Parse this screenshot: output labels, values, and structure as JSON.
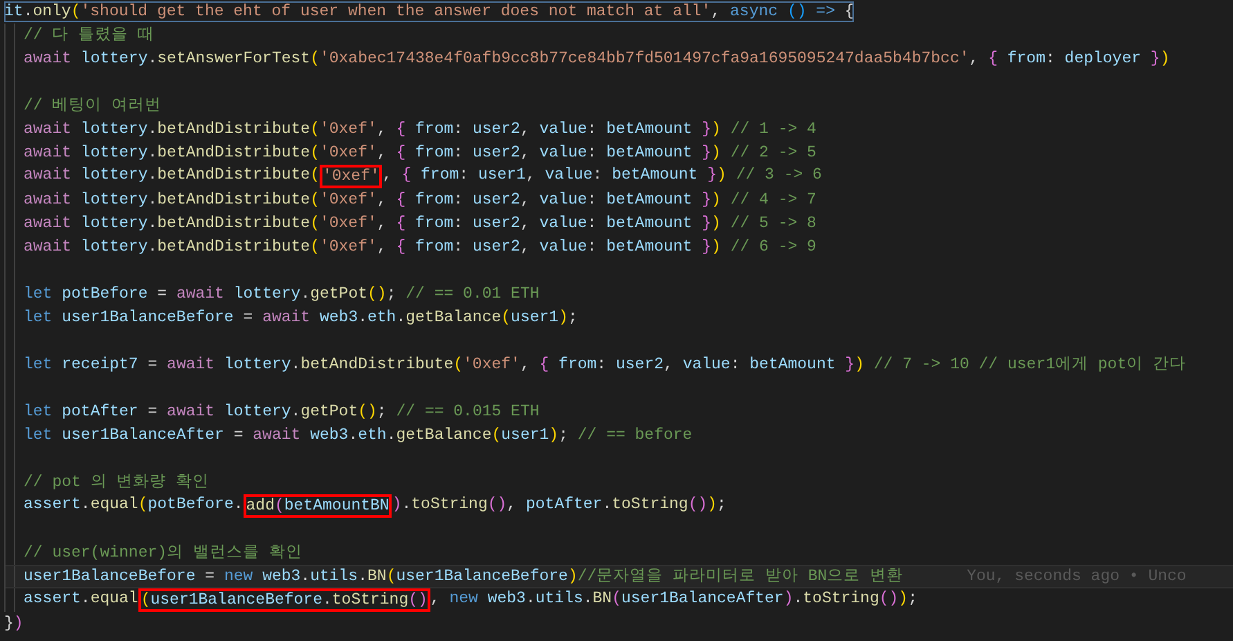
{
  "editor": {
    "header": {
      "outlined": true,
      "segments": [
        {
          "boxed": false,
          "tokens": [
            {
              "kind": "variable",
              "text": "it"
            },
            {
              "kind": "punct",
              "text": "."
            },
            {
              "kind": "function",
              "text": "only"
            },
            {
              "kind": "bracket1",
              "text": "("
            },
            {
              "kind": "string",
              "text": "'should get the eht of user when the answer does not match at all'"
            },
            {
              "kind": "punct",
              "text": ", "
            },
            {
              "kind": "keyword",
              "text": "async "
            },
            {
              "kind": "bracket3",
              "text": "()"
            },
            {
              "kind": "keyword",
              "text": " => "
            },
            {
              "kind": "punct",
              "text": "{"
            }
          ]
        }
      ]
    },
    "body": [
      {
        "current": false,
        "segments": [
          {
            "boxed": false,
            "tokens": [
              {
                "kind": "comment",
                "text": "// 다 틀렸을 때"
              }
            ]
          }
        ]
      },
      {
        "current": false,
        "segments": [
          {
            "boxed": false,
            "tokens": [
              {
                "kind": "control",
                "text": "await "
              },
              {
                "kind": "variable",
                "text": "lottery"
              },
              {
                "kind": "punct",
                "text": "."
              },
              {
                "kind": "function",
                "text": "setAnswerForTest"
              },
              {
                "kind": "bracket1",
                "text": "("
              },
              {
                "kind": "string",
                "text": "'0xabec17438e4f0afb9cc8b77ce84bb7fd501497cfa9a1695095247daa5b4b7bcc'"
              },
              {
                "kind": "punct",
                "text": ", "
              },
              {
                "kind": "bracket2",
                "text": "{"
              },
              {
                "kind": "variable",
                "text": " from"
              },
              {
                "kind": "punct",
                "text": ": "
              },
              {
                "kind": "variable",
                "text": "deployer "
              },
              {
                "kind": "bracket2",
                "text": "}"
              },
              {
                "kind": "bracket1",
                "text": ")"
              }
            ]
          }
        ]
      },
      {
        "current": false
      },
      {
        "current": false,
        "segments": [
          {
            "boxed": false,
            "tokens": [
              {
                "kind": "comment",
                "text": "// 베팅이 여러번"
              }
            ]
          }
        ]
      },
      {
        "current": false,
        "segments": [
          {
            "boxed": false,
            "tokens": [
              {
                "kind": "control",
                "text": "await "
              },
              {
                "kind": "variable",
                "text": "lottery"
              },
              {
                "kind": "punct",
                "text": "."
              },
              {
                "kind": "function",
                "text": "betAndDistribute"
              },
              {
                "kind": "bracket1",
                "text": "("
              },
              {
                "kind": "string",
                "text": "'0xef'"
              },
              {
                "kind": "punct",
                "text": ", "
              },
              {
                "kind": "bracket2",
                "text": "{"
              },
              {
                "kind": "variable",
                "text": " from"
              },
              {
                "kind": "punct",
                "text": ": "
              },
              {
                "kind": "variable",
                "text": "user2"
              },
              {
                "kind": "punct",
                "text": ", "
              },
              {
                "kind": "variable",
                "text": "value"
              },
              {
                "kind": "punct",
                "text": ": "
              },
              {
                "kind": "variable",
                "text": "betAmount "
              },
              {
                "kind": "bracket2",
                "text": "}"
              },
              {
                "kind": "bracket1",
                "text": ")"
              },
              {
                "kind": "comment",
                "text": " // 1 -> 4"
              }
            ]
          }
        ]
      },
      {
        "current": false,
        "segments": [
          {
            "boxed": false,
            "tokens": [
              {
                "kind": "control",
                "text": "await "
              },
              {
                "kind": "variable",
                "text": "lottery"
              },
              {
                "kind": "punct",
                "text": "."
              },
              {
                "kind": "function",
                "text": "betAndDistribute"
              },
              {
                "kind": "bracket1",
                "text": "("
              },
              {
                "kind": "string",
                "text": "'0xef'"
              },
              {
                "kind": "punct",
                "text": ", "
              },
              {
                "kind": "bracket2",
                "text": "{"
              },
              {
                "kind": "variable",
                "text": " from"
              },
              {
                "kind": "punct",
                "text": ": "
              },
              {
                "kind": "variable",
                "text": "user2"
              },
              {
                "kind": "punct",
                "text": ", "
              },
              {
                "kind": "variable",
                "text": "value"
              },
              {
                "kind": "punct",
                "text": ": "
              },
              {
                "kind": "variable",
                "text": "betAmount "
              },
              {
                "kind": "bracket2",
                "text": "}"
              },
              {
                "kind": "bracket1",
                "text": ")"
              },
              {
                "kind": "comment",
                "text": " // 2 -> 5"
              }
            ]
          }
        ]
      },
      {
        "current": false,
        "segments": [
          {
            "boxed": false,
            "tokens": [
              {
                "kind": "control",
                "text": "await "
              },
              {
                "kind": "variable",
                "text": "lottery"
              },
              {
                "kind": "punct",
                "text": "."
              },
              {
                "kind": "function",
                "text": "betAndDistribute"
              },
              {
                "kind": "bracket1",
                "text": "("
              }
            ]
          },
          {
            "boxed": true,
            "tokens": [
              {
                "kind": "string",
                "text": "'0xef'"
              }
            ]
          },
          {
            "boxed": false,
            "tokens": [
              {
                "kind": "punct",
                "text": ", "
              },
              {
                "kind": "bracket2",
                "text": "{"
              },
              {
                "kind": "variable",
                "text": " from"
              },
              {
                "kind": "punct",
                "text": ": "
              },
              {
                "kind": "variable",
                "text": "user1"
              },
              {
                "kind": "punct",
                "text": ", "
              },
              {
                "kind": "variable",
                "text": "value"
              },
              {
                "kind": "punct",
                "text": ": "
              },
              {
                "kind": "variable",
                "text": "betAmount "
              },
              {
                "kind": "bracket2",
                "text": "}"
              },
              {
                "kind": "bracket1",
                "text": ")"
              },
              {
                "kind": "comment",
                "text": " // 3 -> 6"
              }
            ]
          }
        ]
      },
      {
        "current": false,
        "segments": [
          {
            "boxed": false,
            "tokens": [
              {
                "kind": "control",
                "text": "await "
              },
              {
                "kind": "variable",
                "text": "lottery"
              },
              {
                "kind": "punct",
                "text": "."
              },
              {
                "kind": "function",
                "text": "betAndDistribute"
              },
              {
                "kind": "bracket1",
                "text": "("
              },
              {
                "kind": "string",
                "text": "'0xef'"
              },
              {
                "kind": "punct",
                "text": ", "
              },
              {
                "kind": "bracket2",
                "text": "{"
              },
              {
                "kind": "variable",
                "text": " from"
              },
              {
                "kind": "punct",
                "text": ": "
              },
              {
                "kind": "variable",
                "text": "user2"
              },
              {
                "kind": "punct",
                "text": ", "
              },
              {
                "kind": "variable",
                "text": "value"
              },
              {
                "kind": "punct",
                "text": ": "
              },
              {
                "kind": "variable",
                "text": "betAmount "
              },
              {
                "kind": "bracket2",
                "text": "}"
              },
              {
                "kind": "bracket1",
                "text": ")"
              },
              {
                "kind": "comment",
                "text": " // 4 -> 7"
              }
            ]
          }
        ]
      },
      {
        "current": false,
        "segments": [
          {
            "boxed": false,
            "tokens": [
              {
                "kind": "control",
                "text": "await "
              },
              {
                "kind": "variable",
                "text": "lottery"
              },
              {
                "kind": "punct",
                "text": "."
              },
              {
                "kind": "function",
                "text": "betAndDistribute"
              },
              {
                "kind": "bracket1",
                "text": "("
              },
              {
                "kind": "string",
                "text": "'0xef'"
              },
              {
                "kind": "punct",
                "text": ", "
              },
              {
                "kind": "bracket2",
                "text": "{"
              },
              {
                "kind": "variable",
                "text": " from"
              },
              {
                "kind": "punct",
                "text": ": "
              },
              {
                "kind": "variable",
                "text": "user2"
              },
              {
                "kind": "punct",
                "text": ", "
              },
              {
                "kind": "variable",
                "text": "value"
              },
              {
                "kind": "punct",
                "text": ": "
              },
              {
                "kind": "variable",
                "text": "betAmount "
              },
              {
                "kind": "bracket2",
                "text": "}"
              },
              {
                "kind": "bracket1",
                "text": ")"
              },
              {
                "kind": "comment",
                "text": " // 5 -> 8"
              }
            ]
          }
        ]
      },
      {
        "current": false,
        "segments": [
          {
            "boxed": false,
            "tokens": [
              {
                "kind": "control",
                "text": "await "
              },
              {
                "kind": "variable",
                "text": "lottery"
              },
              {
                "kind": "punct",
                "text": "."
              },
              {
                "kind": "function",
                "text": "betAndDistribute"
              },
              {
                "kind": "bracket1",
                "text": "("
              },
              {
                "kind": "string",
                "text": "'0xef'"
              },
              {
                "kind": "punct",
                "text": ", "
              },
              {
                "kind": "bracket2",
                "text": "{"
              },
              {
                "kind": "variable",
                "text": " from"
              },
              {
                "kind": "punct",
                "text": ": "
              },
              {
                "kind": "variable",
                "text": "user2"
              },
              {
                "kind": "punct",
                "text": ", "
              },
              {
                "kind": "variable",
                "text": "value"
              },
              {
                "kind": "punct",
                "text": ": "
              },
              {
                "kind": "variable",
                "text": "betAmount "
              },
              {
                "kind": "bracket2",
                "text": "}"
              },
              {
                "kind": "bracket1",
                "text": ")"
              },
              {
                "kind": "comment",
                "text": " // 6 -> 9"
              }
            ]
          }
        ]
      },
      {
        "current": false
      },
      {
        "current": false,
        "segments": [
          {
            "boxed": false,
            "tokens": [
              {
                "kind": "keyword",
                "text": "let "
              },
              {
                "kind": "variable",
                "text": "potBefore"
              },
              {
                "kind": "punct",
                "text": " = "
              },
              {
                "kind": "control",
                "text": "await "
              },
              {
                "kind": "variable",
                "text": "lottery"
              },
              {
                "kind": "punct",
                "text": "."
              },
              {
                "kind": "function",
                "text": "getPot"
              },
              {
                "kind": "bracket1",
                "text": "()"
              },
              {
                "kind": "punct",
                "text": "; "
              },
              {
                "kind": "comment",
                "text": "// == 0.01 ETH"
              }
            ]
          }
        ]
      },
      {
        "current": false,
        "segments": [
          {
            "boxed": false,
            "tokens": [
              {
                "kind": "keyword",
                "text": "let "
              },
              {
                "kind": "variable",
                "text": "user1BalanceBefore"
              },
              {
                "kind": "punct",
                "text": " = "
              },
              {
                "kind": "control",
                "text": "await "
              },
              {
                "kind": "variable",
                "text": "web3"
              },
              {
                "kind": "punct",
                "text": "."
              },
              {
                "kind": "variable",
                "text": "eth"
              },
              {
                "kind": "punct",
                "text": "."
              },
              {
                "kind": "function",
                "text": "getBalance"
              },
              {
                "kind": "bracket1",
                "text": "("
              },
              {
                "kind": "variable",
                "text": "user1"
              },
              {
                "kind": "bracket1",
                "text": ")"
              },
              {
                "kind": "punct",
                "text": ";"
              }
            ]
          }
        ]
      },
      {
        "current": false
      },
      {
        "current": false,
        "segments": [
          {
            "boxed": false,
            "tokens": [
              {
                "kind": "keyword",
                "text": "let "
              },
              {
                "kind": "variable",
                "text": "receipt7"
              },
              {
                "kind": "punct",
                "text": " = "
              },
              {
                "kind": "control",
                "text": "await "
              },
              {
                "kind": "variable",
                "text": "lottery"
              },
              {
                "kind": "punct",
                "text": "."
              },
              {
                "kind": "function",
                "text": "betAndDistribute"
              },
              {
                "kind": "bracket1",
                "text": "("
              },
              {
                "kind": "string",
                "text": "'0xef'"
              },
              {
                "kind": "punct",
                "text": ", "
              },
              {
                "kind": "bracket2",
                "text": "{"
              },
              {
                "kind": "variable",
                "text": " from"
              },
              {
                "kind": "punct",
                "text": ": "
              },
              {
                "kind": "variable",
                "text": "user2"
              },
              {
                "kind": "punct",
                "text": ", "
              },
              {
                "kind": "variable",
                "text": "value"
              },
              {
                "kind": "punct",
                "text": ": "
              },
              {
                "kind": "variable",
                "text": "betAmount "
              },
              {
                "kind": "bracket2",
                "text": "}"
              },
              {
                "kind": "bracket1",
                "text": ")"
              },
              {
                "kind": "comment",
                "text": " // 7 -> 10 // user1에게 pot이 간다"
              }
            ]
          }
        ]
      },
      {
        "current": false
      },
      {
        "current": false,
        "segments": [
          {
            "boxed": false,
            "tokens": [
              {
                "kind": "keyword",
                "text": "let "
              },
              {
                "kind": "variable",
                "text": "potAfter"
              },
              {
                "kind": "punct",
                "text": " = "
              },
              {
                "kind": "control",
                "text": "await "
              },
              {
                "kind": "variable",
                "text": "lottery"
              },
              {
                "kind": "punct",
                "text": "."
              },
              {
                "kind": "function",
                "text": "getPot"
              },
              {
                "kind": "bracket1",
                "text": "()"
              },
              {
                "kind": "punct",
                "text": "; "
              },
              {
                "kind": "comment",
                "text": "// == 0.015 ETH"
              }
            ]
          }
        ]
      },
      {
        "current": false,
        "segments": [
          {
            "boxed": false,
            "tokens": [
              {
                "kind": "keyword",
                "text": "let "
              },
              {
                "kind": "variable",
                "text": "user1BalanceAfter"
              },
              {
                "kind": "punct",
                "text": " = "
              },
              {
                "kind": "control",
                "text": "await "
              },
              {
                "kind": "variable",
                "text": "web3"
              },
              {
                "kind": "punct",
                "text": "."
              },
              {
                "kind": "variable",
                "text": "eth"
              },
              {
                "kind": "punct",
                "text": "."
              },
              {
                "kind": "function",
                "text": "getBalance"
              },
              {
                "kind": "bracket1",
                "text": "("
              },
              {
                "kind": "variable",
                "text": "user1"
              },
              {
                "kind": "bracket1",
                "text": ")"
              },
              {
                "kind": "punct",
                "text": "; "
              },
              {
                "kind": "comment",
                "text": "// == before"
              }
            ]
          }
        ]
      },
      {
        "current": false
      },
      {
        "current": false,
        "segments": [
          {
            "boxed": false,
            "tokens": [
              {
                "kind": "comment",
                "text": "// pot 의 변화량 확인"
              }
            ]
          }
        ]
      },
      {
        "current": false,
        "segments": [
          {
            "boxed": false,
            "tokens": [
              {
                "kind": "variable",
                "text": "assert"
              },
              {
                "kind": "punct",
                "text": "."
              },
              {
                "kind": "function",
                "text": "equal"
              },
              {
                "kind": "bracket1",
                "text": "("
              },
              {
                "kind": "variable",
                "text": "potBefore"
              },
              {
                "kind": "punct",
                "text": "."
              }
            ]
          },
          {
            "boxed": true,
            "tokens": [
              {
                "kind": "function",
                "text": "add"
              },
              {
                "kind": "bracket2",
                "text": "("
              },
              {
                "kind": "variable",
                "text": "betAmountBN"
              }
            ]
          },
          {
            "boxed": false,
            "tokens": [
              {
                "kind": "bracket2",
                "text": ")"
              },
              {
                "kind": "punct",
                "text": "."
              },
              {
                "kind": "function",
                "text": "toString"
              },
              {
                "kind": "bracket2",
                "text": "()"
              },
              {
                "kind": "punct",
                "text": ", "
              },
              {
                "kind": "variable",
                "text": "potAfter"
              },
              {
                "kind": "punct",
                "text": "."
              },
              {
                "kind": "function",
                "text": "toString"
              },
              {
                "kind": "bracket2",
                "text": "()"
              },
              {
                "kind": "bracket1",
                "text": ")"
              },
              {
                "kind": "punct",
                "text": ";"
              }
            ]
          }
        ]
      },
      {
        "current": false
      },
      {
        "current": false,
        "segments": [
          {
            "boxed": false,
            "tokens": [
              {
                "kind": "comment",
                "text": "// user(winner)의 밸런스를 확인"
              }
            ]
          }
        ]
      },
      {
        "current": true,
        "annotation": "You, seconds ago • Unco",
        "segments": [
          {
            "boxed": false,
            "tokens": [
              {
                "kind": "variable",
                "text": "user1BalanceBefore"
              },
              {
                "kind": "punct",
                "text": " = "
              },
              {
                "kind": "keyword",
                "text": "new "
              },
              {
                "kind": "variable",
                "text": "web3"
              },
              {
                "kind": "punct",
                "text": "."
              },
              {
                "kind": "variable",
                "text": "utils"
              },
              {
                "kind": "punct",
                "text": "."
              },
              {
                "kind": "function",
                "text": "BN"
              },
              {
                "kind": "bracket1",
                "text": "("
              },
              {
                "kind": "variable",
                "text": "user1BalanceBefore"
              },
              {
                "kind": "bracket1",
                "text": ")"
              },
              {
                "kind": "comment",
                "text": "//문자열을 파라미터로 받아 BN으로 변환"
              }
            ]
          }
        ]
      },
      {
        "current": false,
        "segments": [
          {
            "boxed": false,
            "tokens": [
              {
                "kind": "variable",
                "text": "assert"
              },
              {
                "kind": "punct",
                "text": "."
              },
              {
                "kind": "function",
                "text": "equal"
              }
            ]
          },
          {
            "boxed": true,
            "tokens": [
              {
                "kind": "bracket1",
                "text": "("
              },
              {
                "kind": "variable",
                "text": "user1BalanceBefore"
              },
              {
                "kind": "punct",
                "text": "."
              },
              {
                "kind": "function",
                "text": "toString"
              },
              {
                "kind": "bracket2",
                "text": "()"
              }
            ]
          },
          {
            "boxed": false,
            "tokens": [
              {
                "kind": "punct",
                "text": ", "
              },
              {
                "kind": "keyword",
                "text": "new "
              },
              {
                "kind": "variable",
                "text": "web3"
              },
              {
                "kind": "punct",
                "text": "."
              },
              {
                "kind": "variable",
                "text": "utils"
              },
              {
                "kind": "punct",
                "text": "."
              },
              {
                "kind": "function",
                "text": "BN"
              },
              {
                "kind": "bracket2",
                "text": "("
              },
              {
                "kind": "variable",
                "text": "user1BalanceAfter"
              },
              {
                "kind": "bracket2",
                "text": ")"
              },
              {
                "kind": "punct",
                "text": "."
              },
              {
                "kind": "function",
                "text": "toString"
              },
              {
                "kind": "bracket2",
                "text": "()"
              },
              {
                "kind": "bracket1",
                "text": ")"
              },
              {
                "kind": "punct",
                "text": ";"
              }
            ]
          }
        ]
      }
    ],
    "footer": {
      "outlined": false,
      "segments": [
        {
          "boxed": false,
          "tokens": [
            {
              "kind": "punct",
              "text": "}"
            },
            {
              "kind": "bracket2",
              "text": ")"
            }
          ]
        }
      ]
    }
  }
}
